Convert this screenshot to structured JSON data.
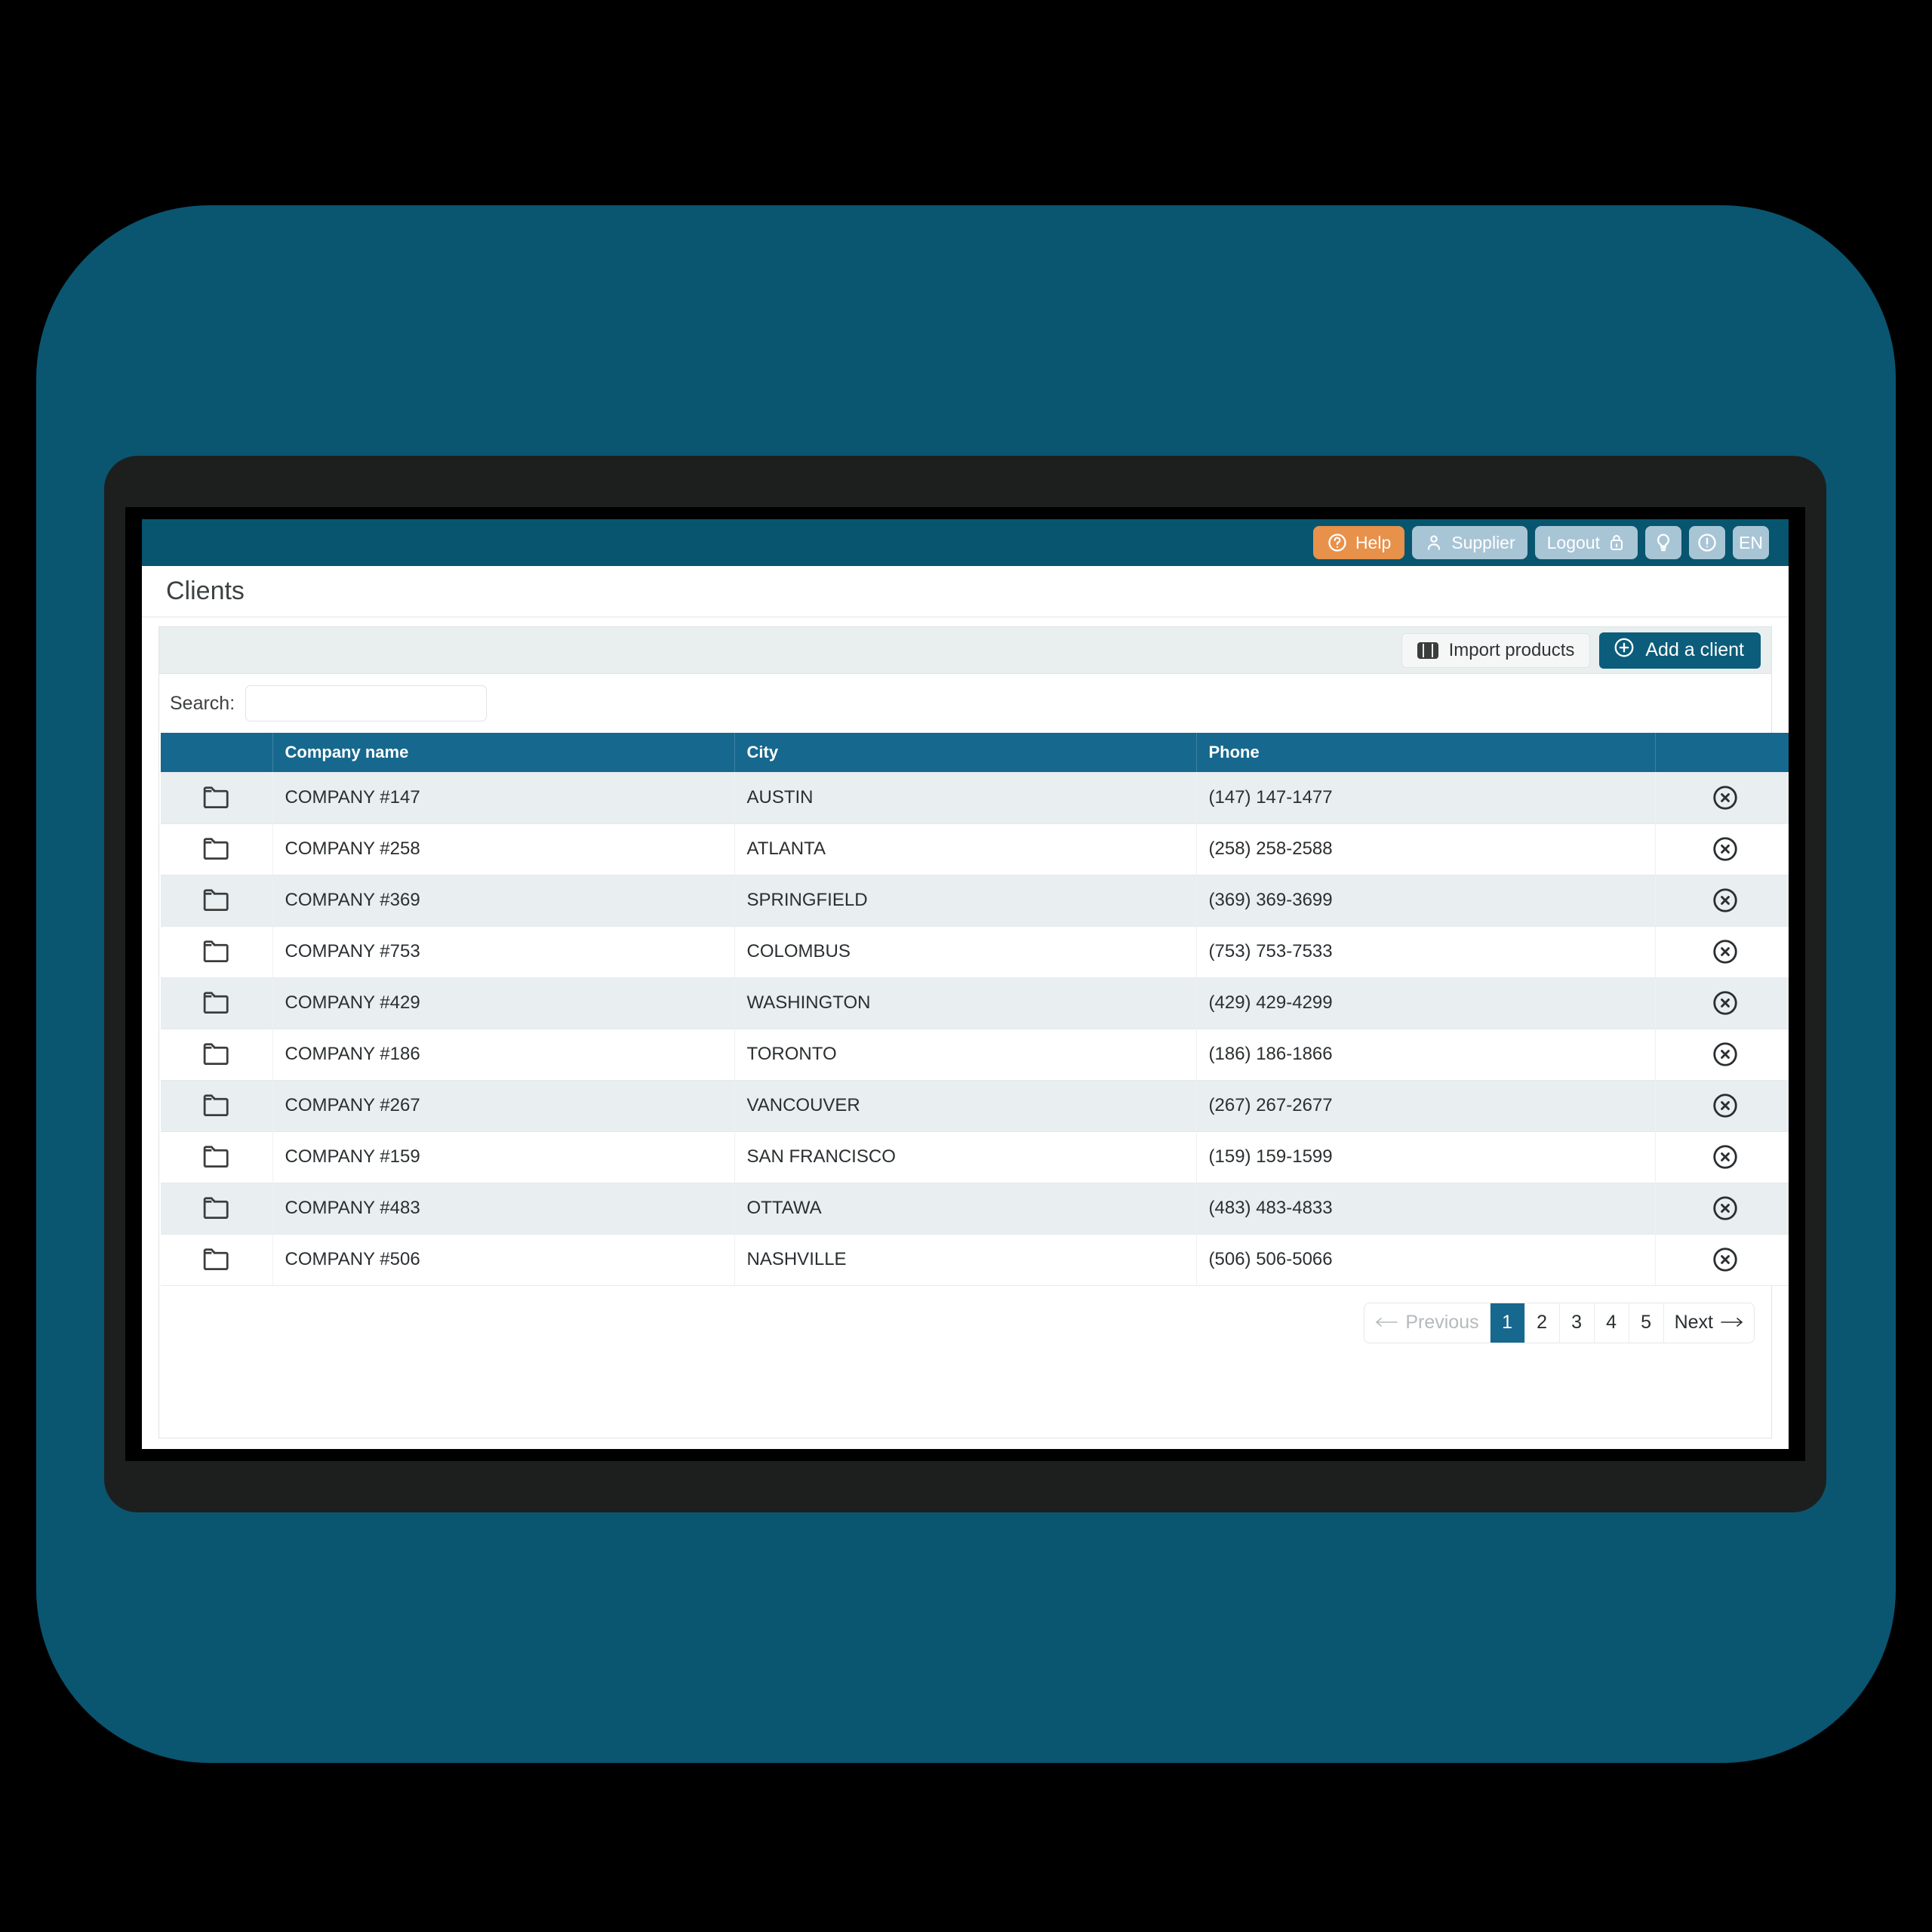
{
  "topbar": {
    "buttons": [
      {
        "name": "help",
        "label": "Help",
        "icon": "question-circle-icon"
      },
      {
        "name": "supplier",
        "label": "Supplier",
        "icon": "user-icon"
      },
      {
        "name": "logout",
        "label": "Logout",
        "icon": "lock-icon"
      },
      {
        "name": "tips",
        "label": "",
        "icon": "lightbulb-icon"
      },
      {
        "name": "alerts",
        "label": "",
        "icon": "exclamation-circle-icon"
      },
      {
        "name": "language",
        "label": "EN",
        "icon": ""
      }
    ],
    "accent_orange": "#e8914b",
    "button_blue": "#a8c5d6",
    "bar_color": "#07556e"
  },
  "page": {
    "title": "Clients"
  },
  "toolbar": {
    "import_label": "Import products",
    "add_label": "Add a client"
  },
  "search": {
    "label": "Search:",
    "value": "",
    "placeholder": ""
  },
  "table": {
    "columns": [
      "",
      "Company name",
      "City",
      "Phone",
      ""
    ],
    "rows": [
      {
        "company": "COMPANY #147",
        "city": "AUSTIN",
        "phone": "(147) 147-1477"
      },
      {
        "company": "COMPANY #258",
        "city": "ATLANTA",
        "phone": "(258) 258-2588"
      },
      {
        "company": "COMPANY #369",
        "city": "SPRINGFIELD",
        "phone": "(369) 369-3699"
      },
      {
        "company": "COMPANY #753",
        "city": "COLOMBUS",
        "phone": "(753) 753-7533"
      },
      {
        "company": "COMPANY #429",
        "city": "WASHINGTON",
        "phone": "(429) 429-4299"
      },
      {
        "company": "COMPANY #186",
        "city": "TORONTO",
        "phone": "(186) 186-1866"
      },
      {
        "company": "COMPANY #267",
        "city": "VANCOUVER",
        "phone": "(267) 267-2677"
      },
      {
        "company": "COMPANY #159",
        "city": "SAN FRANCISCO",
        "phone": "(159) 159-1599"
      },
      {
        "company": "COMPANY #483",
        "city": "OTTAWA",
        "phone": "(483) 483-4833"
      },
      {
        "company": "COMPANY #506",
        "city": "NASHVILLE",
        "phone": "(506) 506-5066"
      }
    ],
    "header_color": "#16688e",
    "stripe_color": "#e9eef0"
  },
  "pagination": {
    "previous_label": "Previous",
    "next_label": "Next",
    "pages": [
      "1",
      "2",
      "3",
      "4",
      "5"
    ],
    "active_page": "1",
    "active_color": "#16688e"
  },
  "frame": {
    "backdrop_color": "#0a5570",
    "bezel_color": "#1d1f1e"
  }
}
